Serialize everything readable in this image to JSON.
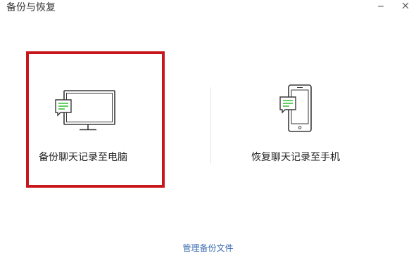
{
  "window": {
    "title": "备份与恢复"
  },
  "options": {
    "backup": {
      "label": "备份聊天记录至电脑",
      "icon": "monitor-chat-icon",
      "selected": true
    },
    "restore": {
      "label": "恢复聊天记录至手机",
      "icon": "phone-chat-icon",
      "selected": false
    }
  },
  "footer": {
    "manage_label": "管理备份文件"
  },
  "colors": {
    "selection_border": "#c8161d",
    "chat_bubble_lines": "#3fbf3f",
    "icon_stroke": "#3a3a3a",
    "link": "#3d6db0"
  }
}
